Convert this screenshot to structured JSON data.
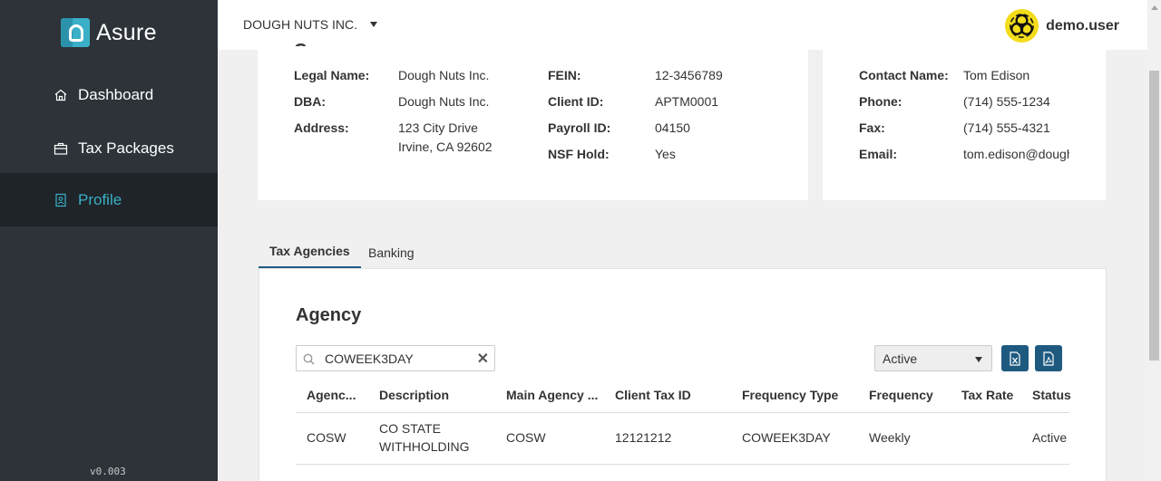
{
  "app": {
    "logo_text": "Asure",
    "version": "v0.003"
  },
  "sidebar": {
    "items": [
      {
        "label": "Dashboard",
        "icon": "home-icon",
        "active": false
      },
      {
        "label": "Tax Packages",
        "icon": "briefcase-icon",
        "active": false
      },
      {
        "label": "Profile",
        "icon": "id-badge-icon",
        "active": true
      }
    ]
  },
  "header": {
    "company": "DOUGH NUTS INC.",
    "user": {
      "name": "demo.user",
      "avatar_icon": "biohazard-icon"
    }
  },
  "company_info": {
    "legal_name_label": "Legal Name:",
    "legal_name": "Dough Nuts Inc.",
    "dba_label": "DBA:",
    "dba": "Dough Nuts Inc.",
    "address_label": "Address:",
    "address_line1": "123 City Drive",
    "address_line2": "Irvine, CA 92602",
    "fein_label": "FEIN:",
    "fein": "12-3456789",
    "client_id_label": "Client ID:",
    "client_id": "APTM0001",
    "payroll_id_label": "Payroll ID:",
    "payroll_id": "04150",
    "nsf_hold_label": "NSF Hold:",
    "nsf_hold": "Yes"
  },
  "contact": {
    "name_label": "Contact Name:",
    "name": "Tom Edison",
    "phone_label": "Phone:",
    "phone": "(714) 555-1234",
    "fax_label": "Fax:",
    "fax": "(714) 555-4321",
    "email_label": "Email:",
    "email": "tom.edison@dough"
  },
  "tabs": [
    {
      "label": "Tax Agencies",
      "active": true
    },
    {
      "label": "Banking",
      "active": false
    }
  ],
  "agency": {
    "title": "Agency",
    "search_value": "COWEEK3DAY",
    "status_filter": "Active",
    "columns": [
      "Agenc...",
      "Description",
      "Main Agency ...",
      "Client Tax ID",
      "Frequency Type",
      "Frequency",
      "Tax Rate",
      "Status"
    ],
    "rows": [
      {
        "agency": "COSW",
        "description_line1": "CO STATE",
        "description_line2": "WITHHOLDING",
        "main_agency": "COSW",
        "client_tax_id": "12121212",
        "frequency_type": "COWEEK3DAY",
        "frequency": "Weekly",
        "tax_rate": "",
        "status": "Active"
      }
    ]
  },
  "colors": {
    "sidebar_bg": "#2d3339",
    "accent": "#3ab0c8",
    "button": "#1e5a80",
    "avatar": "#f3dc1a"
  }
}
